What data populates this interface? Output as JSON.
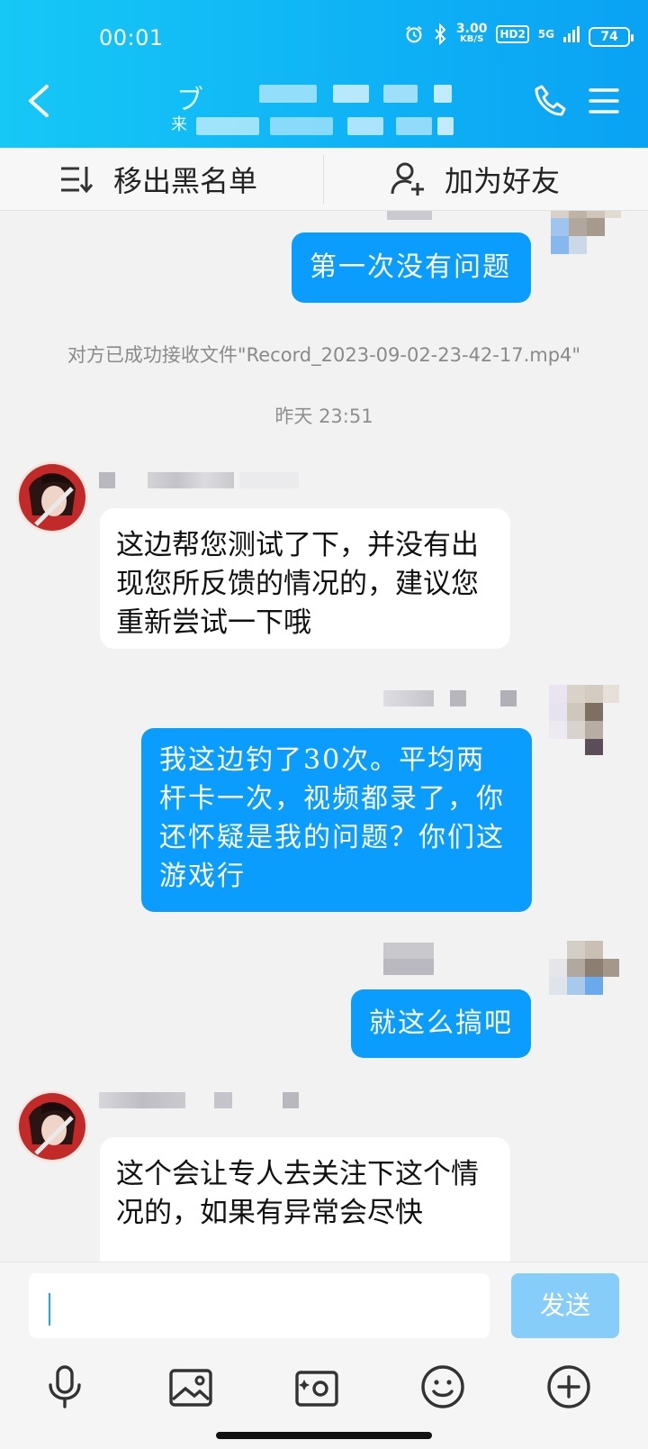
{
  "status_bar": {
    "time": "00:01",
    "net_speed_value": "3.00",
    "net_speed_unit": "KB/S",
    "hd_label": "HD2",
    "network": "5G",
    "battery": "74"
  },
  "header": {
    "title_visible_char": "ブ",
    "subtitle_visible_char": "来"
  },
  "action_bar": {
    "remove_blacklist_label": "移出黑名单",
    "add_friend_label": "加为好友"
  },
  "messages": [
    {
      "side": "out",
      "text": "第一次没有问题"
    },
    {
      "side": "out",
      "text": "我这边钓了30次。平均两杆卡一次，视频都录了，你还怀疑是我的问题？你们这游戏行"
    },
    {
      "side": "out",
      "text": "就这么搞吧"
    }
  ],
  "incoming": [
    {
      "side": "in",
      "text": "这边帮您测试了下，并没有出现您所反馈的情况的，建议您重新尝试一下哦"
    },
    {
      "side": "in",
      "text": "这个会让专人去关注下这个情况的，如果有异常会尽快"
    }
  ],
  "system": {
    "file_received": "对方已成功接收文件\"Record_2023-09-02-23-42-17.mp4\"",
    "timestamp": "昨天 23:51"
  },
  "composer": {
    "input_value": "",
    "send_label": "发送"
  },
  "colors": {
    "header": "#12b8f5",
    "outgoing_bubble": "#0b9dfd",
    "incoming_bubble": "#ffffff",
    "send_disabled": "#86cdfa"
  },
  "icons": [
    "back-icon",
    "phone-icon",
    "menu-icon",
    "blacklist-icon",
    "add-friend-icon",
    "mic-icon",
    "image-icon",
    "camera-icon",
    "emoji-icon",
    "plus-icon"
  ]
}
